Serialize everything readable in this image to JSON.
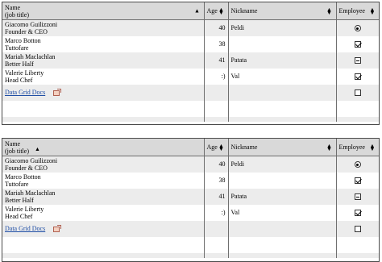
{
  "columns": {
    "name_line1": "Name",
    "name_line2": "(job title)",
    "age": "Age",
    "nickname": "Nickname",
    "employee": "Employee"
  },
  "rows": [
    {
      "name": "Giacomo Guilizzoni",
      "title": "Founder & CEO",
      "age": "40",
      "nickname": "Peldi",
      "employee": "radio-selected"
    },
    {
      "name": "Marco Botton",
      "title": "Tuttofare",
      "age": "38",
      "nickname": "",
      "employee": "checked"
    },
    {
      "name": "Mariah Maclachlan",
      "title": "Better Half",
      "age": "41",
      "nickname": "Patata",
      "employee": "indeterminate"
    },
    {
      "name": "Valerie Liberty",
      "title": "Head Chef",
      "age": ":)",
      "nickname": "Val",
      "employee": "checked"
    }
  ],
  "link": {
    "label": "Data Grid Docs",
    "icon": "external-doc-icon"
  },
  "footer_employee_state": "unchecked",
  "grid1_sort_indicator": "▲",
  "grid2_sort_indicator": "▲",
  "sort_both": "⬍"
}
